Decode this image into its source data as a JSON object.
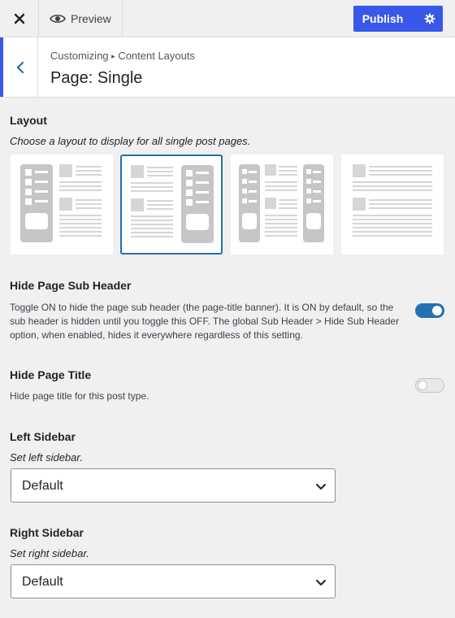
{
  "topbar": {
    "close_icon": "close-icon",
    "preview_label": "Preview",
    "publish_label": "Publish",
    "accent": "#3858e9"
  },
  "header": {
    "breadcrumb_root": "Customizing",
    "breadcrumb_sep": "▸",
    "breadcrumb_section": "Content Layouts",
    "title": "Page: Single"
  },
  "layout": {
    "title": "Layout",
    "description": "Choose a layout to display for all single post pages.",
    "options": [
      {
        "name": "left-sidebar",
        "selected": false
      },
      {
        "name": "right-sidebar",
        "selected": true
      },
      {
        "name": "both-sidebars",
        "selected": false
      },
      {
        "name": "no-sidebar",
        "selected": false
      }
    ]
  },
  "hide_sub_header": {
    "title": "Hide Page Sub Header",
    "description": "Toggle ON to hide the page sub header (the page-title banner). It is ON by default, so the sub header is hidden until you toggle this OFF. The global Sub Header > Hide Sub Header option, when enabled, hides it everywhere regardless of this setting.",
    "enabled": true
  },
  "hide_page_title": {
    "title": "Hide Page Title",
    "description": "Hide page title for this post type.",
    "enabled": false
  },
  "left_sidebar": {
    "title": "Left Sidebar",
    "description": "Set left sidebar.",
    "value": "Default"
  },
  "right_sidebar": {
    "title": "Right Sidebar",
    "description": "Set right sidebar.",
    "value": "Default"
  }
}
